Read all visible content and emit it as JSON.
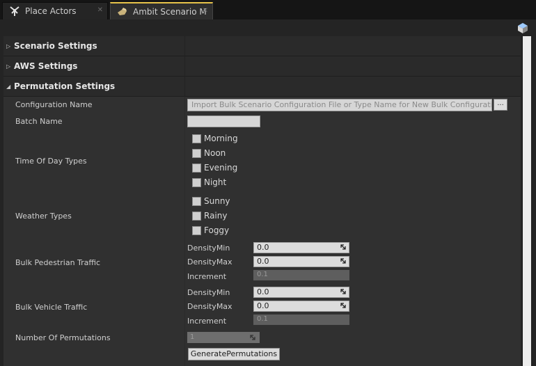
{
  "tabs": [
    {
      "label": "Place Actors",
      "icon": "place-actors-icon"
    },
    {
      "label": "Ambit Scenario M",
      "icon": "ambit-scenario-icon"
    }
  ],
  "toolbar": {
    "icon": "cube-icon"
  },
  "sections": {
    "scenario": "Scenario Settings",
    "aws": "AWS Settings",
    "permutation": "Permutation Settings"
  },
  "permutation": {
    "config_name_label": "Configuration Name",
    "config_name_placeholder": "Import Bulk Scenario Configuration File or Type Name for New Bulk Configuratio",
    "browse_label": "...",
    "batch_name_label": "Batch Name",
    "batch_name_value": "",
    "time_of_day_label": "Time Of Day Types",
    "time_of_day": [
      "Morning",
      "Noon",
      "Evening",
      "Night"
    ],
    "weather_label": "Weather Types",
    "weather": [
      "Sunny",
      "Rainy",
      "Foggy"
    ],
    "pedestrian": {
      "label": "Bulk Pedestrian Traffic",
      "min_label": "DensityMin",
      "min": "0.0",
      "max_label": "DensityMax",
      "max": "0.0",
      "inc_label": "Increment",
      "inc": "0.1"
    },
    "vehicle": {
      "label": "Bulk Vehicle Traffic",
      "min_label": "DensityMin",
      "min": "0.0",
      "max_label": "DensityMax",
      "max": "0.0",
      "inc_label": "Increment",
      "inc": "0.1"
    },
    "num_permutations_label": "Number Of Permutations",
    "num_permutations": "1",
    "generate_label": "GeneratePermutations"
  }
}
